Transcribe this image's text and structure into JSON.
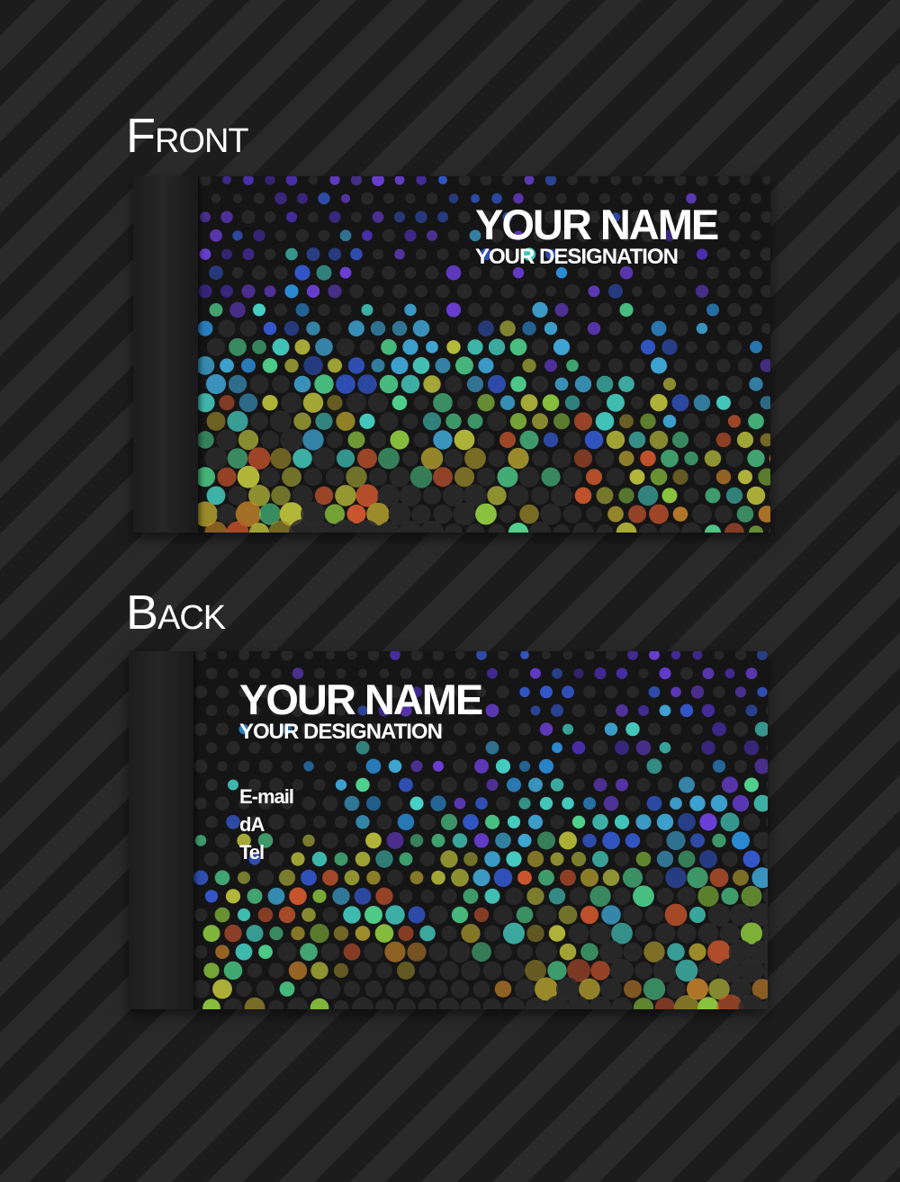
{
  "front": {
    "heading": "Front",
    "name": "YOUR NAME",
    "designation": "YOUR DESIGNATION"
  },
  "back": {
    "heading": "Back",
    "name": "YOUR NAME",
    "designation": "YOUR DESIGNATION",
    "contacts": [
      "E-mail",
      "dA",
      "Tel"
    ]
  },
  "colors": {
    "background": "#222223",
    "card": "#151516",
    "text": "#ffffff",
    "dot_palette": [
      "#4b2fb0",
      "#6a3fd6",
      "#3fa7d6",
      "#46d1c4",
      "#4fd08c",
      "#8cc63f",
      "#b5b93a",
      "#a08f2c",
      "#c7842b",
      "#c8552d",
      "#3357c9",
      "#2c8fd8"
    ]
  }
}
